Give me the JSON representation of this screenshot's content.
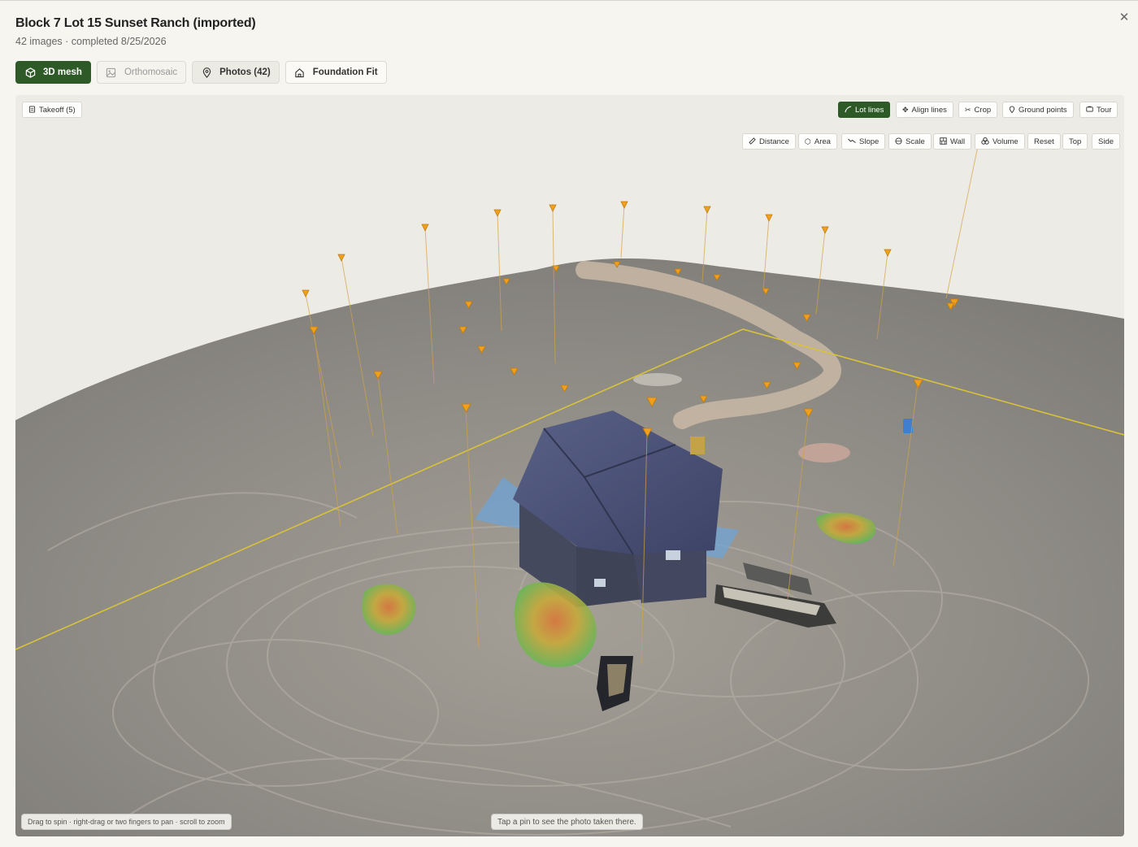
{
  "header": {
    "title": "Block 7 Lot 15 Sunset Ranch (imported)",
    "subtitle": "42 images · completed 8/25/2026"
  },
  "tabs": [
    {
      "label": "3D mesh",
      "icon": "cube-icon",
      "state": "active"
    },
    {
      "label": "Orthomosaic",
      "icon": "image-icon",
      "state": "disabled"
    },
    {
      "label": "Photos (42)",
      "icon": "map-pin-icon",
      "state": "default"
    },
    {
      "label": "Foundation Fit",
      "icon": "home-icon",
      "state": "default"
    }
  ],
  "viewer": {
    "takeoff_label": "Takeoff (5)",
    "top_toolbar": [
      {
        "label": "Lot lines",
        "icon": "pencil-curve-icon",
        "active": true
      },
      {
        "label": "Align lines",
        "icon": "move-icon",
        "active": false
      },
      {
        "label": "Crop",
        "icon": "scissors-icon",
        "active": false
      },
      {
        "label": "Ground points",
        "icon": "map-pin-icon",
        "active": false
      },
      {
        "label": "Tour",
        "icon": "camera-icon",
        "active": false
      }
    ],
    "measure_toolbar": [
      {
        "label": "Distance",
        "icon": "ruler-icon"
      },
      {
        "label": "Area",
        "icon": "hexagon-icon"
      },
      {
        "label": "Slope",
        "icon": "slope-icon"
      },
      {
        "label": "Scale",
        "icon": "scale-icon"
      },
      {
        "label": "Wall",
        "icon": "wall-icon"
      },
      {
        "label": "Volume",
        "icon": "volume-icon"
      },
      {
        "label": "Reset",
        "icon": ""
      },
      {
        "label": "Top",
        "icon": ""
      },
      {
        "label": "Side",
        "icon": ""
      }
    ],
    "hint_controls": "Drag to spin · right-drag or two fingers to pan · scroll to zoom",
    "hint_pins": "Tap a pin to see the photo taken there."
  },
  "colors": {
    "accent_green": "#2d5a27",
    "pin_orange": "#f0a01c",
    "lot_line": "#d9c23a",
    "roof": "#4a5177",
    "terrain": "#8f8c86"
  }
}
